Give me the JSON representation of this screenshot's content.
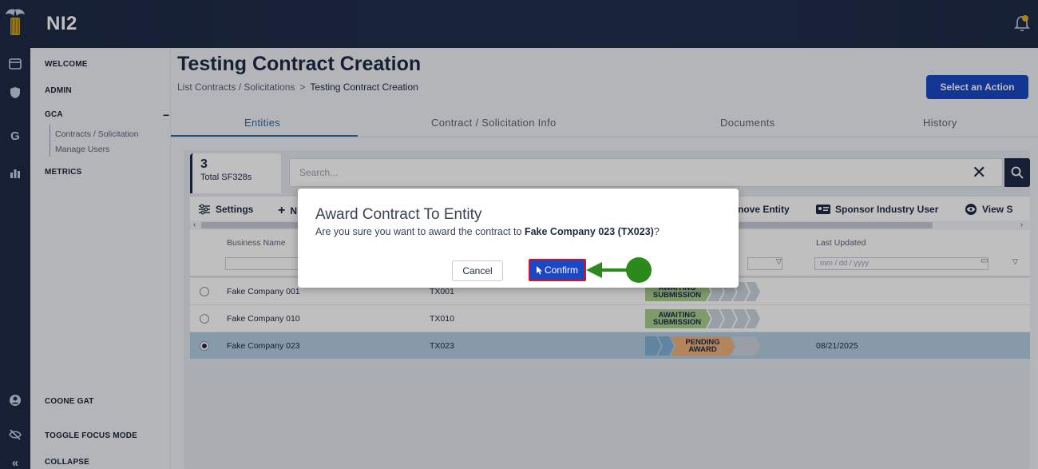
{
  "app": {
    "title": "NI2"
  },
  "sidebar": {
    "items": [
      {
        "label": "WELCOME"
      },
      {
        "label": "ADMIN"
      },
      {
        "label": "GCA",
        "toggle": "−"
      },
      {
        "label": "METRICS"
      }
    ],
    "gca_subitems": [
      {
        "label": "Contracts / Solicitation"
      },
      {
        "label": "Manage Users"
      }
    ],
    "bottom": [
      {
        "label": "COONE GAT"
      },
      {
        "label": "TOGGLE FOCUS MODE"
      },
      {
        "label": "COLLAPSE"
      }
    ]
  },
  "page": {
    "title": "Testing Contract Creation",
    "breadcrumb": {
      "parent": "List Contracts / Solicitations",
      "separator": ">",
      "current": "Testing Contract Creation"
    },
    "action_button": "Select an Action"
  },
  "tabs": [
    {
      "label": "Entities",
      "active": true
    },
    {
      "label": "Contract / Solicitation Info",
      "active": false
    },
    {
      "label": "Documents",
      "active": false
    },
    {
      "label": "History",
      "active": false
    }
  ],
  "summary": {
    "count": "3",
    "label": "Total SF328s"
  },
  "search": {
    "placeholder": "Search..."
  },
  "toolbar": {
    "settings": "Settings",
    "add_prefix": "N",
    "remove_entity": "nove Entity",
    "sponsor": "Sponsor Industry User",
    "view": "View S"
  },
  "table": {
    "headers": {
      "business_name": "Business Name",
      "last_updated": "Last Updated"
    },
    "date_placeholder": "mm / dd / yyyy",
    "rows": [
      {
        "name": "Fake Company 001",
        "code": "TX001",
        "status": "AWAITING SUBMISSION",
        "updated": "",
        "selected": false
      },
      {
        "name": "Fake Company 010",
        "code": "TX010",
        "status": "AWAITING SUBMISSION",
        "updated": "",
        "selected": false
      },
      {
        "name": "Fake Company 023",
        "code": "TX023",
        "status": "PENDING AWARD",
        "updated": "08/21/2025",
        "selected": true
      }
    ]
  },
  "modal": {
    "title": "Award Contract To Entity",
    "body_prefix": "Are you sure you want to award the contract to ",
    "body_entity": "Fake Company 023 (TX023)",
    "body_suffix": "?",
    "cancel": "Cancel",
    "confirm": "Confirm"
  },
  "colors": {
    "primary": "#1a47c4",
    "nav_dark": "#1e2a45",
    "awaiting_green": "#a9cf8f",
    "pending_orange": "#f0b07a",
    "highlight_red": "#e0101a",
    "annotation_green": "#2a8a1a"
  }
}
